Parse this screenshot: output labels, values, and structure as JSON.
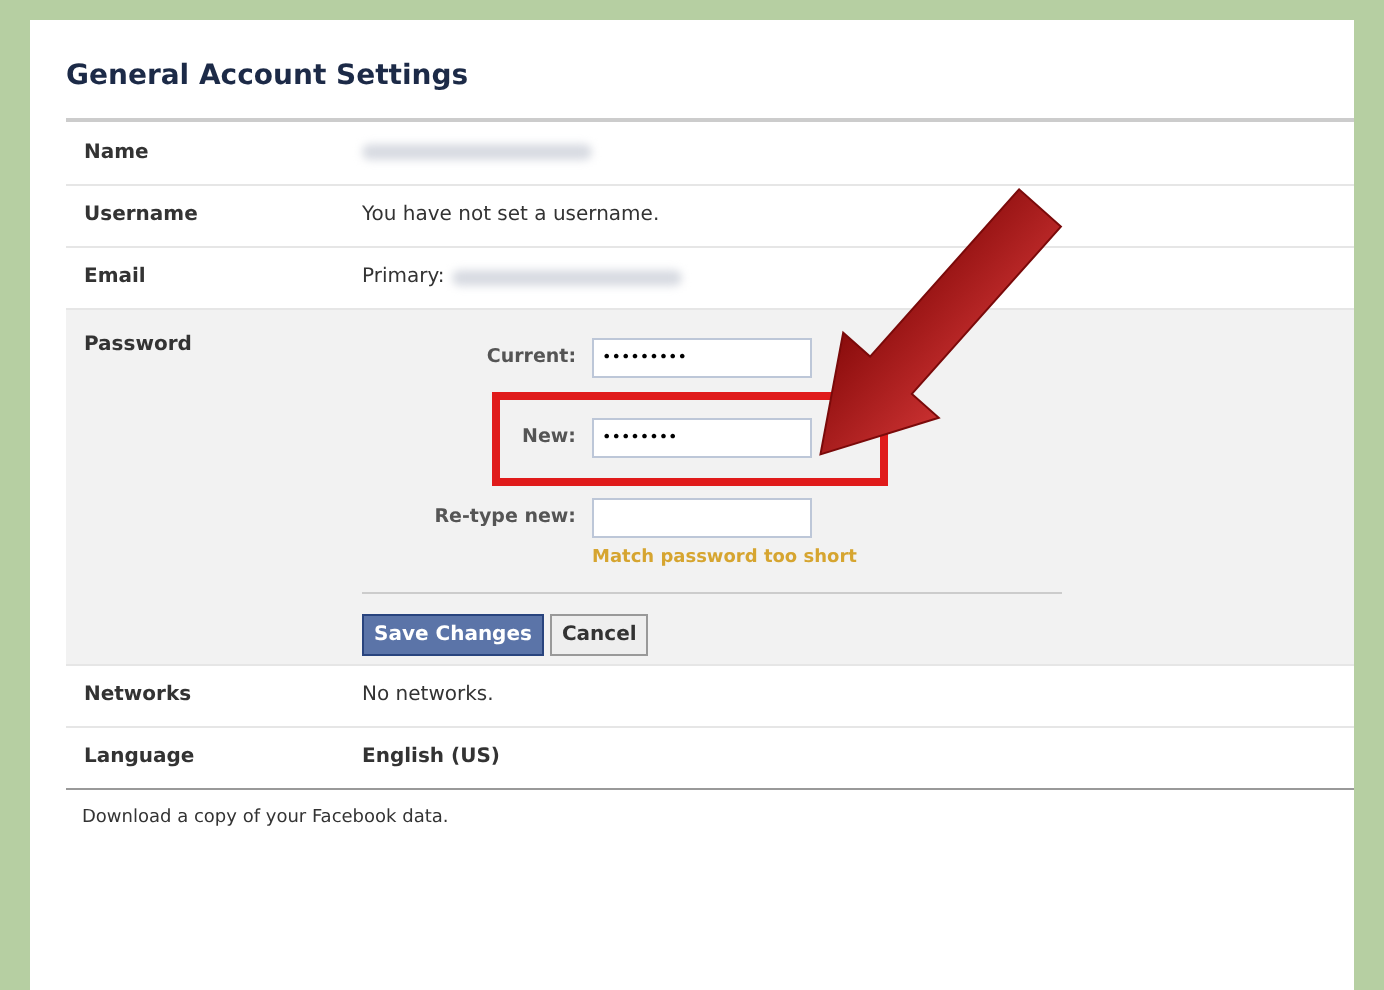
{
  "title": "General Account Settings",
  "rows": [
    {
      "kind": "text",
      "label": "Name",
      "blurred": true
    },
    {
      "kind": "text",
      "label": "Username",
      "value": "You have not set a username.",
      "blurred": false
    },
    {
      "kind": "text",
      "label": "Email",
      "value": "Primary:",
      "blurred": true
    },
    {
      "kind": "password",
      "label": "Password",
      "fields": [
        {
          "label": "Current:",
          "value": "•••••••••"
        },
        {
          "label": "New:",
          "value": "••••••••"
        },
        {
          "label": "Re-type new:",
          "hint": "Match password too short"
        }
      ],
      "buttons": [
        {
          "label": "Save Changes",
          "kind": "primary"
        },
        {
          "label": "Cancel",
          "kind": "secondary"
        }
      ]
    },
    {
      "kind": "text",
      "label": "Networks",
      "value": "No networks.",
      "blurred": false
    },
    {
      "kind": "text",
      "label": "Language",
      "value": "English (US)",
      "emphasis": true,
      "blurred": false
    }
  ],
  "footer": "Download a copy of your Facebook data."
}
